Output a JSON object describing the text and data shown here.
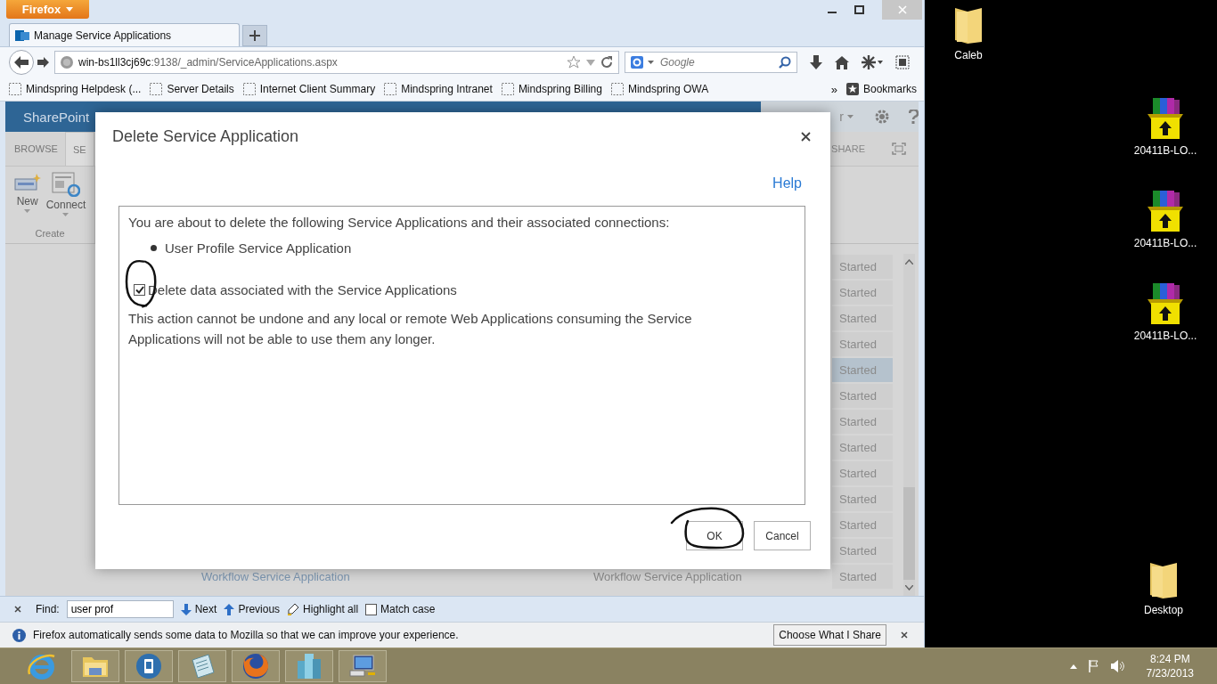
{
  "browser": {
    "app_button": "Firefox",
    "tabs": [
      {
        "title": "Manage Service Applications",
        "selected": true
      }
    ],
    "url": {
      "host": "win-bs1ll3cj69c",
      "rest": ":9138/_admin/ServiceApplications.aspx"
    },
    "search": {
      "placeholder": "Google"
    },
    "bookmarks": [
      "Mindspring Helpdesk (...",
      "Server Details",
      "Internet Client Summary",
      "Mindspring Intranet",
      "Mindspring Billing",
      "Mindspring OWA"
    ],
    "overflow": "»",
    "bookmarks_menu": "Bookmarks"
  },
  "page": {
    "brand": "SharePoint",
    "user_menu": "r",
    "ribbon_tabs": [
      {
        "label": "BROWSE",
        "selected": false
      },
      {
        "label": "SE",
        "selected": true
      }
    ],
    "share": "SHARE",
    "ribbon_buttons": [
      "New",
      "Connect"
    ],
    "ribbon_group": "Create",
    "rows": [
      {
        "status": "Started",
        "selected": false
      },
      {
        "status": "Started",
        "selected": false
      },
      {
        "status": "Started",
        "selected": false
      },
      {
        "status": "Started",
        "selected": false
      },
      {
        "status": "Started",
        "selected": true
      },
      {
        "status": "Started",
        "selected": false
      },
      {
        "status": "Started",
        "selected": false
      },
      {
        "status": "Started",
        "selected": false
      },
      {
        "status": "Started",
        "selected": false
      },
      {
        "status": "Started",
        "selected": false
      },
      {
        "status": "Started",
        "selected": false
      },
      {
        "status": "Started",
        "selected": false
      },
      {
        "status": "Started",
        "selected": false,
        "name": "Workflow Service Application",
        "type": "Workflow Service Application"
      }
    ]
  },
  "dialog": {
    "title": "Delete Service Application",
    "help": "Help",
    "intro": "You are about to delete the following Service Applications and their associated connections:",
    "items": [
      "User Profile Service Application"
    ],
    "option": {
      "label": "Delete data associated with the Service Applications",
      "checked": true
    },
    "warning": "This action cannot be undone and any local or remote Web Applications consuming the Service Applications will not be able to use them any longer.",
    "buttons": [
      "OK",
      "Cancel"
    ]
  },
  "find_bar": {
    "label": "Find:",
    "value": "user prof",
    "next": "Next",
    "previous": "Previous",
    "highlight": "Highlight all",
    "match_case": {
      "label": "Match case",
      "checked": false
    }
  },
  "notification": {
    "text": "Firefox automatically sends some data to Mozilla so that we can improve your experience.",
    "button": "Choose What I Share"
  },
  "desktop": {
    "icons": [
      {
        "label": "Caleb",
        "kind": "folder"
      },
      {
        "label": "20411B-LO...",
        "kind": "archive"
      },
      {
        "label": "20411B-LO...",
        "kind": "archive"
      },
      {
        "label": "20411B-LO...",
        "kind": "archive"
      },
      {
        "label": "Desktop",
        "kind": "folder"
      }
    ]
  },
  "taskbar": {
    "time": "8:24 PM",
    "date": "7/23/2013"
  }
}
